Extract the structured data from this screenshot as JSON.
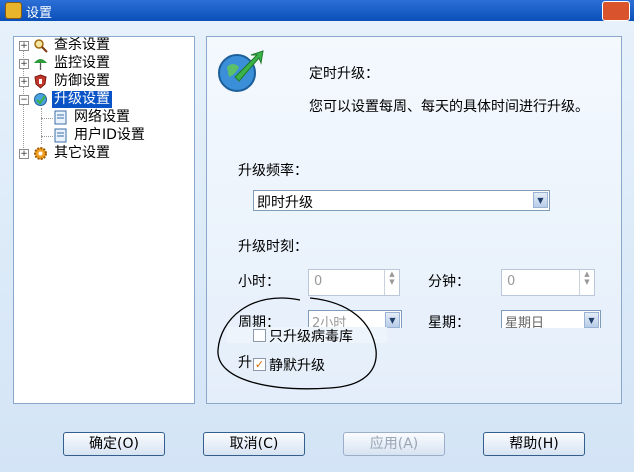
{
  "window": {
    "title": "设置"
  },
  "tree": {
    "items": [
      {
        "label": "查杀设置",
        "icon": "magnifier-icon"
      },
      {
        "label": "监控设置",
        "icon": "umbrella-icon"
      },
      {
        "label": "防御设置",
        "icon": "shield-icon"
      },
      {
        "label": "升级设置",
        "icon": "update-globe-icon",
        "selected": true
      },
      {
        "label": "网络设置",
        "icon": "page-icon",
        "child": true
      },
      {
        "label": "用户ID设置",
        "icon": "page-icon",
        "child": true
      },
      {
        "label": "其它设置",
        "icon": "gear-icon"
      }
    ]
  },
  "panel": {
    "heading": "定时升级：",
    "description": "您可以设置每周、每天的具体时间进行升级。",
    "frequency_label": "升级频率：",
    "frequency_value": "即时升级",
    "time_label": "升级时刻：",
    "hour_label": "小时：",
    "hour_value": "0",
    "minute_label": "分钟：",
    "minute_value": "0",
    "period_label": "周期：",
    "period_value": "2小时",
    "weekday_label": "星期：",
    "weekday_value": "星期日",
    "virus_only_label": "只升级病毒库",
    "virus_only_checked": false,
    "mode_label_partial": "升",
    "silent_label": "静默升级",
    "silent_checked": true
  },
  "buttons": {
    "ok": "确定(O)",
    "cancel": "取消(C)",
    "apply": "应用(A)",
    "help": "帮助(H)"
  }
}
